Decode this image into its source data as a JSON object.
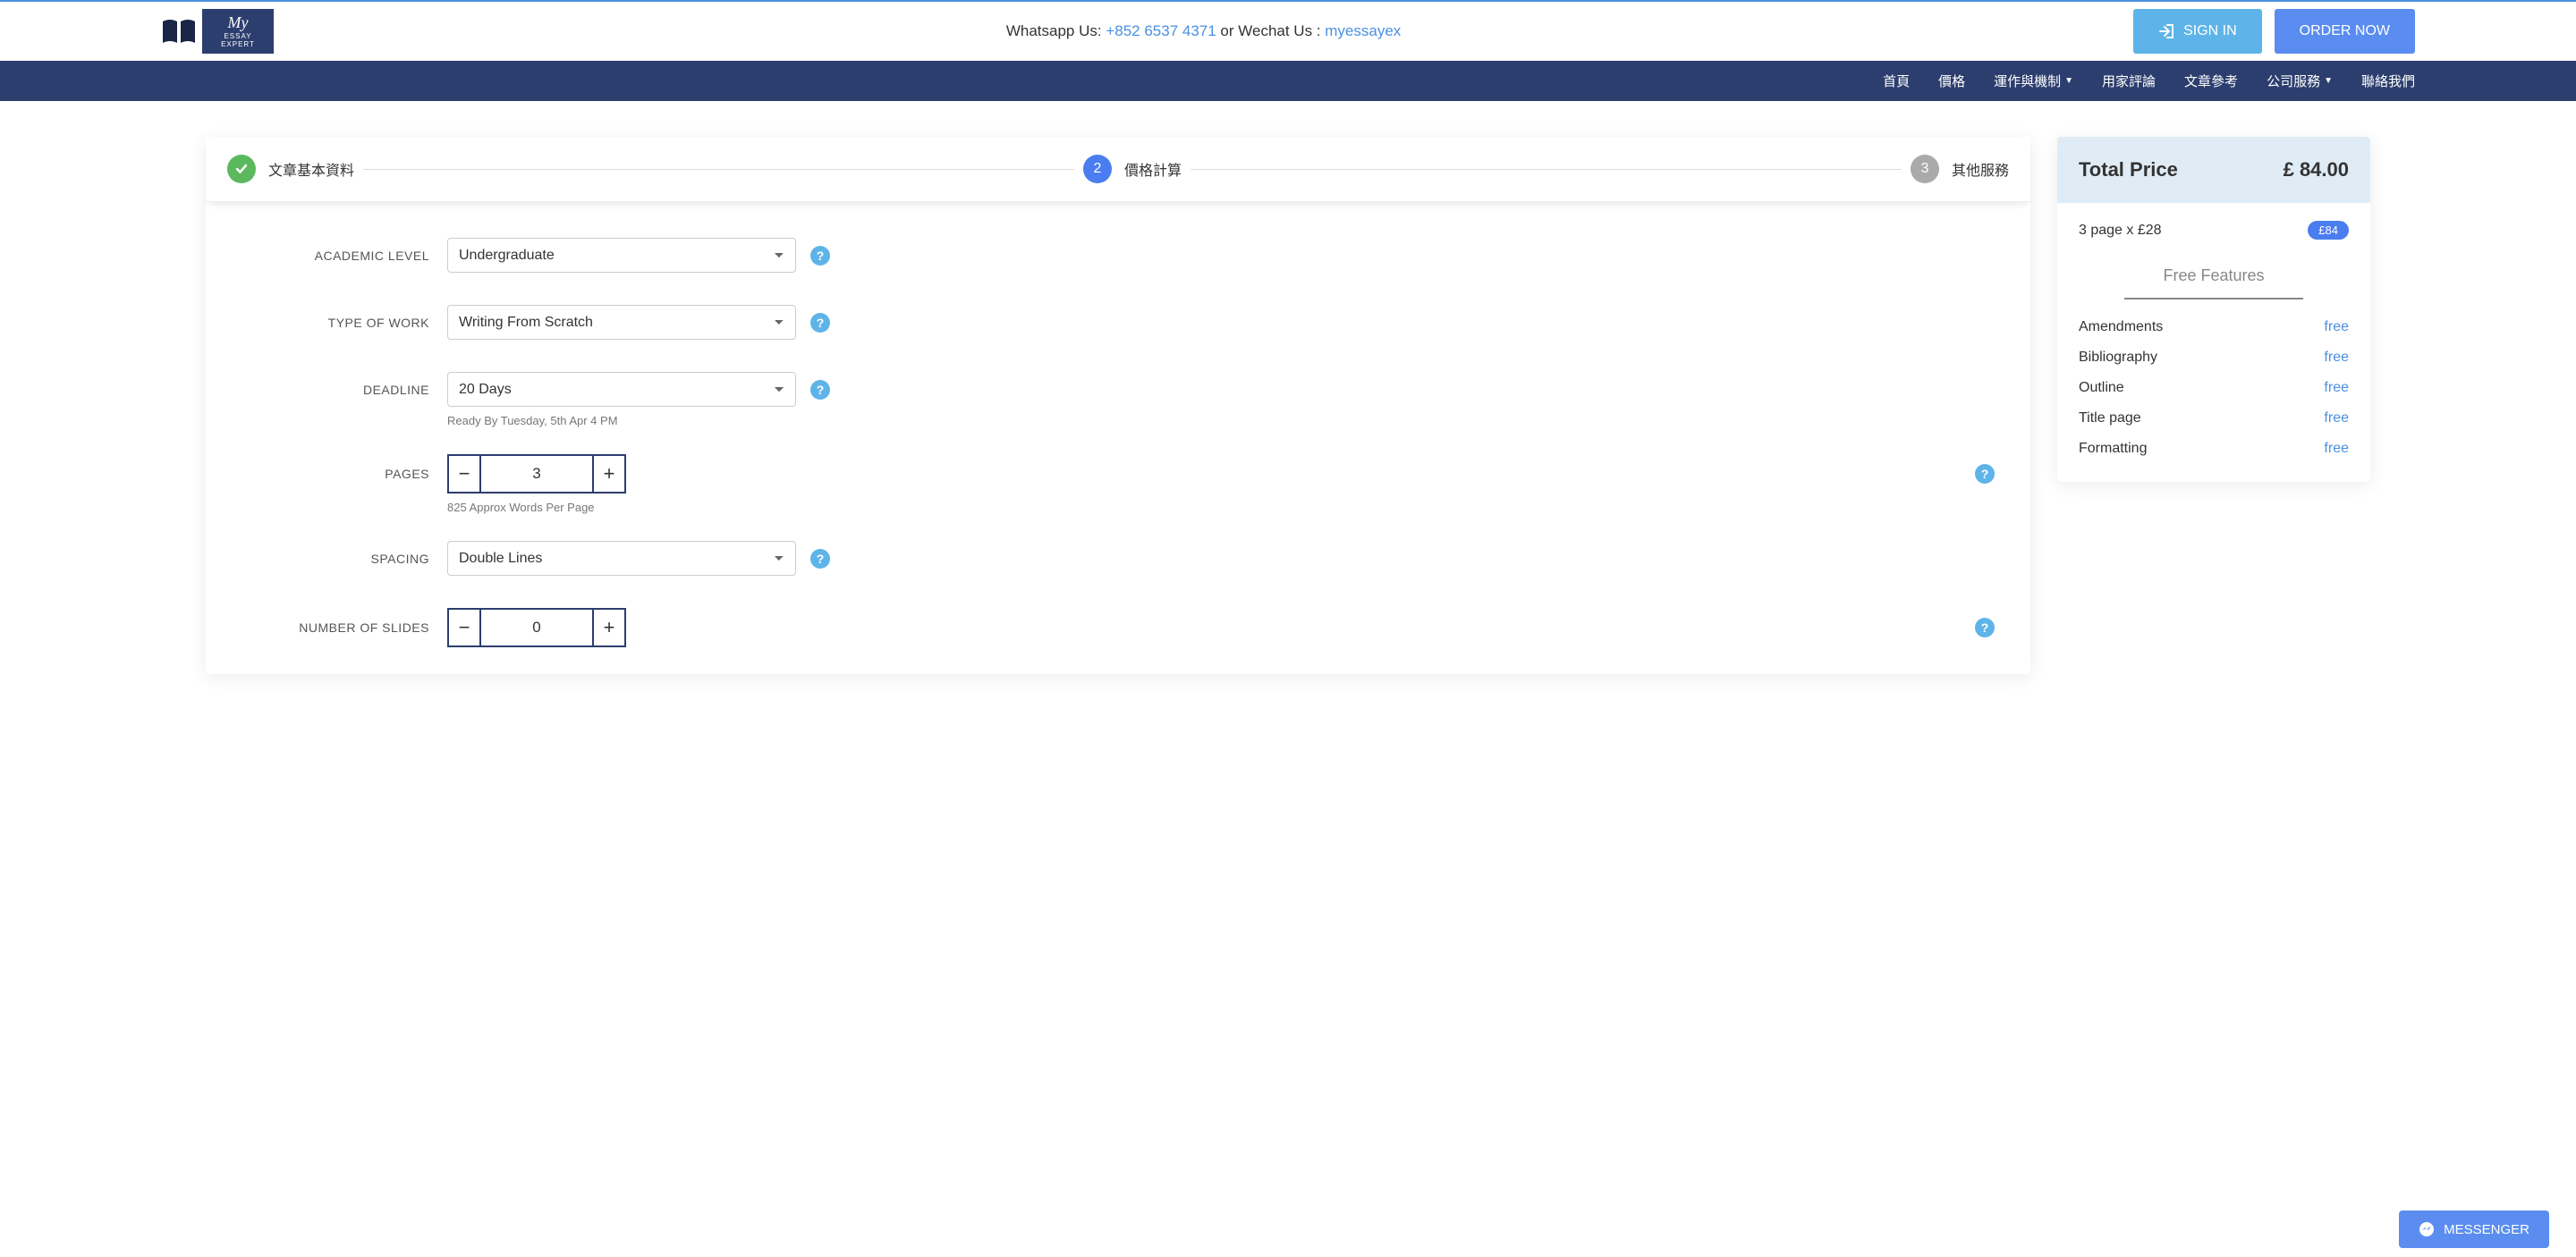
{
  "topbar": {
    "contact_prefix": "Whatsapp Us: ",
    "phone": "+852 6537 4371",
    "contact_mid": " or Wechat Us : ",
    "wechat": "myessayex",
    "logo_script": "My",
    "logo_sub": "ESSAY EXPERT",
    "signin": "SIGN IN",
    "ordernow": "ORDER NOW"
  },
  "nav": {
    "home": "首頁",
    "price": "價格",
    "how": "運作與機制",
    "reviews": "用家評論",
    "samples": "文章參考",
    "services": "公司服務",
    "contact": "聯絡我們"
  },
  "steps": {
    "s1": "文章基本資料",
    "s2_num": "2",
    "s2": "價格計算",
    "s3_num": "3",
    "s3": "其他服務"
  },
  "form": {
    "academic_label": "ACADEMIC LEVEL",
    "academic_value": "Undergraduate",
    "typework_label": "TYPE OF WORK",
    "typework_value": "Writing From Scratch",
    "deadline_label": "DEADLINE",
    "deadline_value": "20 Days",
    "deadline_note": "Ready By Tuesday, 5th Apr 4 PM",
    "pages_label": "PAGES",
    "pages_value": "3",
    "pages_note": "825 Approx Words Per Page",
    "spacing_label": "SPACING",
    "spacing_value": "Double Lines",
    "slides_label": "NUMBER OF SLIDES",
    "slides_value": "0"
  },
  "sidebar": {
    "total_label": "Total Price",
    "total_price": "£ 84.00",
    "line_desc": "3 page x £28",
    "line_pill": "£84",
    "features_head": "Free Features",
    "features": [
      {
        "name": "Amendments",
        "val": "free"
      },
      {
        "name": "Bibliography",
        "val": "free"
      },
      {
        "name": "Outline",
        "val": "free"
      },
      {
        "name": "Title page",
        "val": "free"
      },
      {
        "name": "Formatting",
        "val": "free"
      }
    ]
  },
  "messenger": "MESSENGER"
}
